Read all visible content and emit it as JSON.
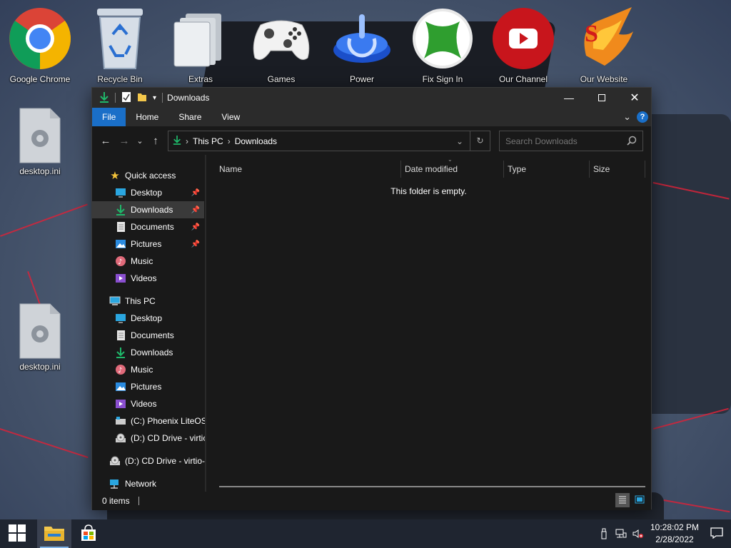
{
  "desktop": {
    "icons": [
      {
        "label": "Google Chrome"
      },
      {
        "label": "Recycle Bin"
      },
      {
        "label": "Extras"
      },
      {
        "label": "Games"
      },
      {
        "label": "Power"
      },
      {
        "label": "Fix Sign In"
      },
      {
        "label": "Our Channel"
      },
      {
        "label": "Our Website"
      }
    ],
    "files": [
      {
        "label": "desktop.ini"
      },
      {
        "label": "desktop.ini"
      }
    ]
  },
  "window": {
    "title": "Downloads",
    "ribbon_tabs": [
      {
        "label": "File"
      },
      {
        "label": "Home"
      },
      {
        "label": "Share"
      },
      {
        "label": "View"
      }
    ],
    "help_label": "?",
    "address": {
      "crumbs": [
        "This PC",
        "Downloads"
      ]
    },
    "search": {
      "placeholder": "Search Downloads"
    },
    "nav": {
      "quick_access": "Quick access",
      "quick_items": [
        {
          "label": "Desktop",
          "pinned": true
        },
        {
          "label": "Downloads",
          "pinned": true,
          "selected": true
        },
        {
          "label": "Documents",
          "pinned": true
        },
        {
          "label": "Pictures",
          "pinned": true
        },
        {
          "label": "Music"
        },
        {
          "label": "Videos"
        }
      ],
      "this_pc": "This PC",
      "pc_items": [
        {
          "label": "Desktop"
        },
        {
          "label": "Documents"
        },
        {
          "label": "Downloads"
        },
        {
          "label": "Music"
        },
        {
          "label": "Pictures"
        },
        {
          "label": "Videos"
        },
        {
          "label": "(C:) Phoenix LiteOS"
        },
        {
          "label": "(D:) CD Drive - virtic"
        }
      ],
      "drive": "(D:) CD Drive - virtio-",
      "network": "Network"
    },
    "columns": [
      {
        "label": "Name"
      },
      {
        "label": "Date modified"
      },
      {
        "label": "Type"
      },
      {
        "label": "Size"
      }
    ],
    "empty_message": "This folder is empty.",
    "status": "0 items"
  },
  "taskbar": {
    "clock_time": "10:28:02 PM",
    "clock_date": "2/28/2022"
  },
  "colors": {
    "accent": "#1a6fc8",
    "window_bg": "#191919",
    "titlebar_bg": "#2b2b2b",
    "taskbar_bg": "#1f2530"
  }
}
